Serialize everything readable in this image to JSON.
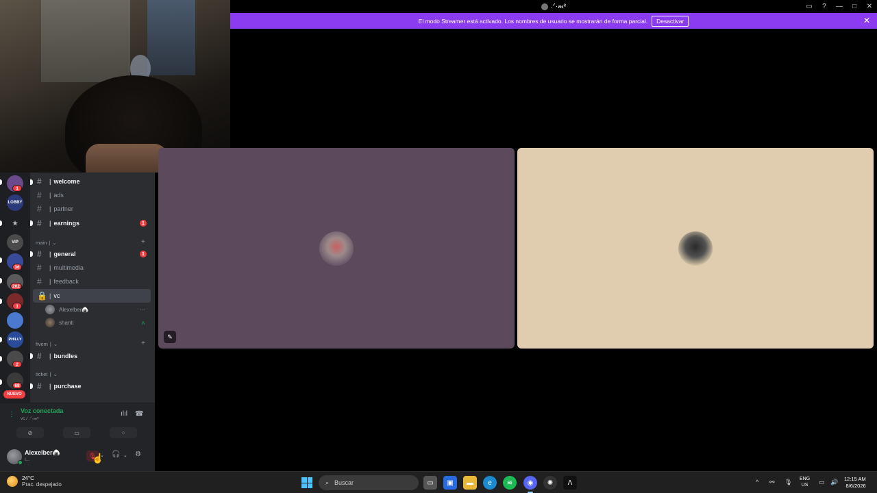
{
  "window": {
    "title": ".ᐟ·𝓂ᵉ",
    "controls": [
      "inbox-icon",
      "help-icon",
      "minimize-icon",
      "maximize-icon",
      "close-icon"
    ]
  },
  "banner": {
    "text": "El modo Streamer está activado. Los nombres de usuario se mostrarán de forma parcial.",
    "button": "Desactivar"
  },
  "server_rail": {
    "servers": [
      {
        "label": "",
        "badge": "1",
        "color": "#6a4a8a"
      },
      {
        "label": "LOBBY",
        "badge": "",
        "color": "#2a3a7a"
      },
      {
        "label": "★",
        "badge": "",
        "color": "#1e1f22"
      },
      {
        "label": "VIP",
        "badge": "",
        "color": "#4a4a4a"
      },
      {
        "label": "",
        "badge": "36",
        "color": "#3a4a9a"
      },
      {
        "label": "",
        "badge": "202",
        "color": "#5a5a5a"
      },
      {
        "label": "",
        "badge": "1",
        "color": "#7a2a2a"
      },
      {
        "label": "",
        "badge": "",
        "color": "#4a7ad0"
      },
      {
        "label": "PHILLY",
        "badge": "",
        "color": "#2a4a9a"
      },
      {
        "label": "",
        "badge": "2",
        "color": "#4a4a4a"
      },
      {
        "label": "",
        "badge": "68",
        "color": "#3a3a3a"
      }
    ],
    "new_label": "NUEVO"
  },
  "channels": {
    "top": [
      {
        "name": "welcome",
        "unread": true,
        "mention": ""
      },
      {
        "name": "ads",
        "unread": false,
        "mention": ""
      },
      {
        "name": "partner",
        "unread": false,
        "mention": ""
      },
      {
        "name": "earnings",
        "unread": true,
        "mention": "1"
      }
    ],
    "category_main": "main",
    "main": [
      {
        "name": "general",
        "unread": true,
        "mention": "1"
      },
      {
        "name": "multimedia",
        "unread": false,
        "mention": ""
      },
      {
        "name": "feedback",
        "unread": false,
        "mention": ""
      }
    ],
    "voice_channel": "vc",
    "voice_users": [
      {
        "name": "Alexelber🍙",
        "icon": "⋯"
      },
      {
        "name": "shanti",
        "icon": "∧"
      }
    ],
    "category_fivem": "fivem",
    "fivem": [
      {
        "name": "bundles",
        "unread": true
      }
    ],
    "category_ticket": "ticket",
    "ticket": [
      {
        "name": "purchase",
        "unread": true
      }
    ]
  },
  "voice_panel": {
    "status": "Voz conectada",
    "channel": "vc / .ᐟ·𝓂ᵉ"
  },
  "user": {
    "name": "Alexelber🍙",
    "status": "I..."
  },
  "taskbar": {
    "temp": "24°C",
    "weather": "Prac. despejado",
    "search_placeholder": "Buscar",
    "lang_top": "ENG",
    "lang_bottom": "US",
    "time": "12:15 AM",
    "date": "8/6/2026"
  }
}
